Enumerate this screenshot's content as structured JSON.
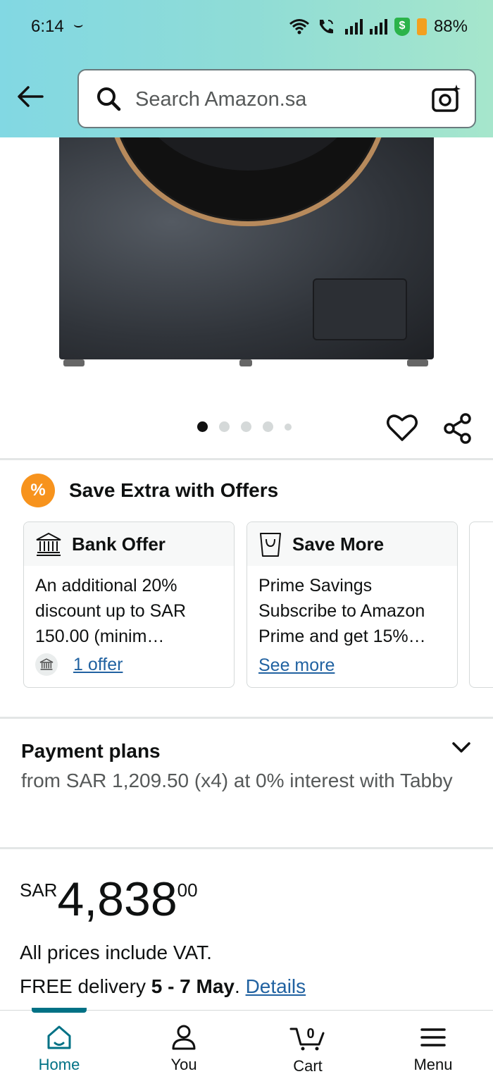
{
  "status_bar": {
    "time": "6:14",
    "battery": "88%"
  },
  "search": {
    "placeholder": "Search Amazon.sa"
  },
  "carousel": {
    "total": 5,
    "active": 1
  },
  "offers": {
    "title": "Save Extra with Offers",
    "cards": [
      {
        "title": "Bank Offer",
        "text": "An additional 20% discount up to SAR 150.00 (minim…",
        "link": "1 offer"
      },
      {
        "title": "Save More",
        "text": "Prime Savings Subscribe to Amazon Prime and get 15%…",
        "link": "See more"
      }
    ]
  },
  "payment": {
    "title": "Payment plans",
    "text": "from SAR 1,209.50 (x4) at 0% interest with Tabby"
  },
  "price": {
    "currency": "SAR",
    "whole": "4,838",
    "fraction": "00"
  },
  "vat_note": "All prices include VAT.",
  "delivery": {
    "prefix": "FREE delivery ",
    "dates": "5 - 7 May",
    "suffix": ". ",
    "link": "Details"
  },
  "tabs": {
    "home": "Home",
    "you": "You",
    "cart": "Cart",
    "cart_count": "0",
    "menu": "Menu"
  },
  "colors": {
    "accent": "#007185",
    "link": "#2162a1",
    "offer_badge": "#f7931d"
  }
}
